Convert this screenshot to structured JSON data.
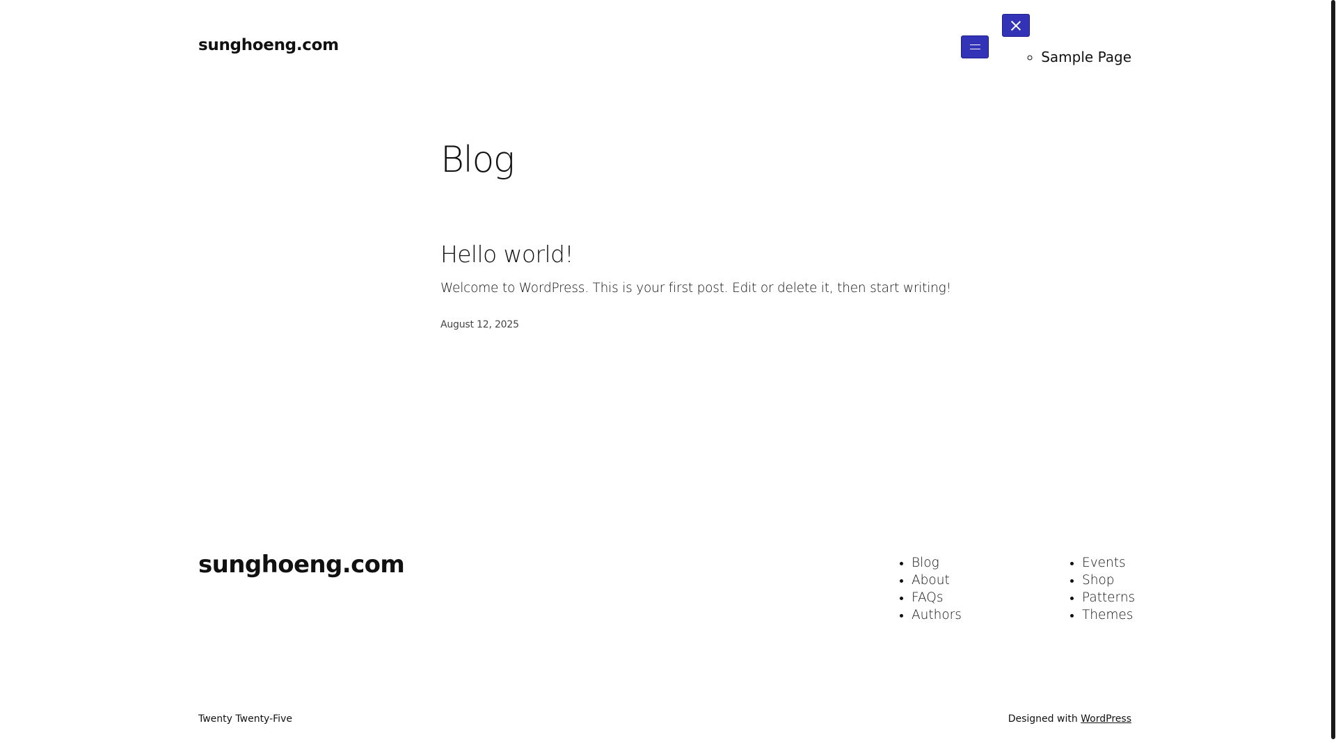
{
  "header": {
    "site_title": "sunghoeng.com",
    "nav_items": [
      "Sample Page"
    ]
  },
  "main": {
    "heading": "Blog",
    "posts": [
      {
        "title": "Hello world!",
        "excerpt": "Welcome to WordPress. This is your first post. Edit or delete it, then start writing!",
        "date": "August 12, 2025"
      }
    ]
  },
  "footer": {
    "site_title": "sunghoeng.com",
    "nav_col1": [
      "Blog",
      "About",
      "FAQs",
      "Authors"
    ],
    "nav_col2": [
      "Events",
      "Shop",
      "Patterns",
      "Themes"
    ],
    "theme_credit": "Twenty Twenty-Five",
    "designed_with_prefix": "Designed with ",
    "designed_with_link": "WordPress"
  },
  "colors": {
    "accent": "#3333b8",
    "text": "#111111",
    "background": "#ffffff"
  },
  "icons": {
    "open_menu": "hamburger-icon",
    "close_menu": "close-icon"
  }
}
